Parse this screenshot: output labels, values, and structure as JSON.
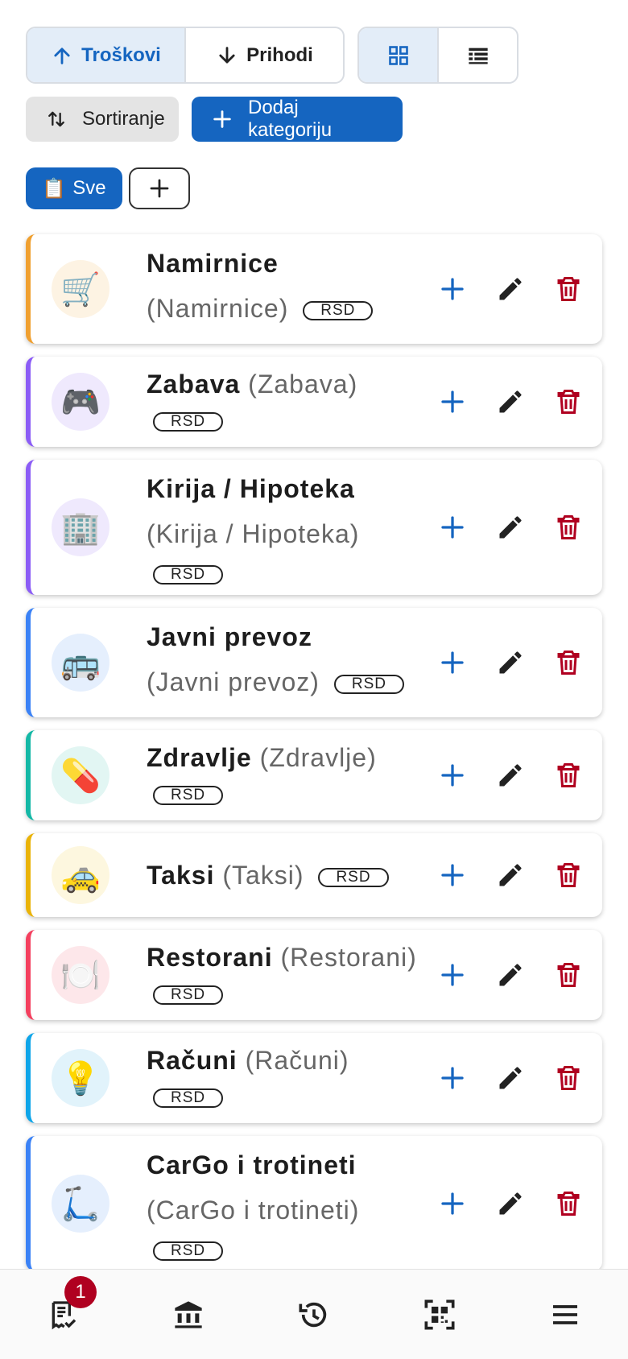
{
  "type_toggle": {
    "expenses_label": "Troškovi",
    "income_label": "Prihodi",
    "selected": "expenses"
  },
  "view_toggle": {
    "selected": "grid",
    "grid_icon": "grid-icon",
    "list_icon": "list-icon"
  },
  "toolbar": {
    "sort_label": "Sortiranje",
    "add_category_label": "Dodaj kategoriju"
  },
  "filter": {
    "all_emoji": "📋",
    "all_label": "Sve"
  },
  "categories": [
    {
      "name": "Namirnice",
      "original": "(Namirnice)",
      "currency": "RSD",
      "emoji": "🛒",
      "accent": "#f0a030",
      "icon_bg": "#fdf3e3"
    },
    {
      "name": "Zabava",
      "original": "(Zabava)",
      "currency": "RSD",
      "emoji": "🎮",
      "accent": "#8b5cf6",
      "icon_bg": "#efe9fd"
    },
    {
      "name": "Kirija / Hipoteka",
      "original": "(Kirija / Hipoteka)",
      "currency": "RSD",
      "emoji": "🏢",
      "accent": "#8b5cf6",
      "icon_bg": "#efe9fd"
    },
    {
      "name": "Javni prevoz",
      "original": "(Javni prevoz)",
      "currency": "RSD",
      "emoji": "🚌",
      "accent": "#3b82f6",
      "icon_bg": "#e5effd"
    },
    {
      "name": "Zdravlje",
      "original": "(Zdravlje)",
      "currency": "RSD",
      "emoji": "💊",
      "accent": "#14b8a6",
      "icon_bg": "#e2f6f3"
    },
    {
      "name": "Taksi",
      "original": "(Taksi)",
      "currency": "RSD",
      "emoji": "🚕",
      "accent": "#eab308",
      "icon_bg": "#fdf7df"
    },
    {
      "name": "Restorani",
      "original": "(Restorani)",
      "currency": "RSD",
      "emoji": "🍽️",
      "accent": "#f43f5e",
      "icon_bg": "#fde7ea"
    },
    {
      "name": "Računi",
      "original": "(Računi)",
      "currency": "RSD",
      "emoji": "💡",
      "accent": "#0ea5e9",
      "icon_bg": "#e1f3fb"
    },
    {
      "name": "CarGo i trotineti",
      "original": "(CarGo i trotineti)",
      "currency": "RSD",
      "emoji": "🛴",
      "accent": "#3b82f6",
      "icon_bg": "#e5effd"
    }
  ],
  "bottom_nav": {
    "items": [
      "receipts-icon",
      "bank-icon",
      "history-icon",
      "qr-scan-icon",
      "menu-icon"
    ],
    "receipts_badge": "1"
  },
  "colors": {
    "primary": "#1565c0",
    "delete": "#b00020",
    "edit": "#222222"
  }
}
